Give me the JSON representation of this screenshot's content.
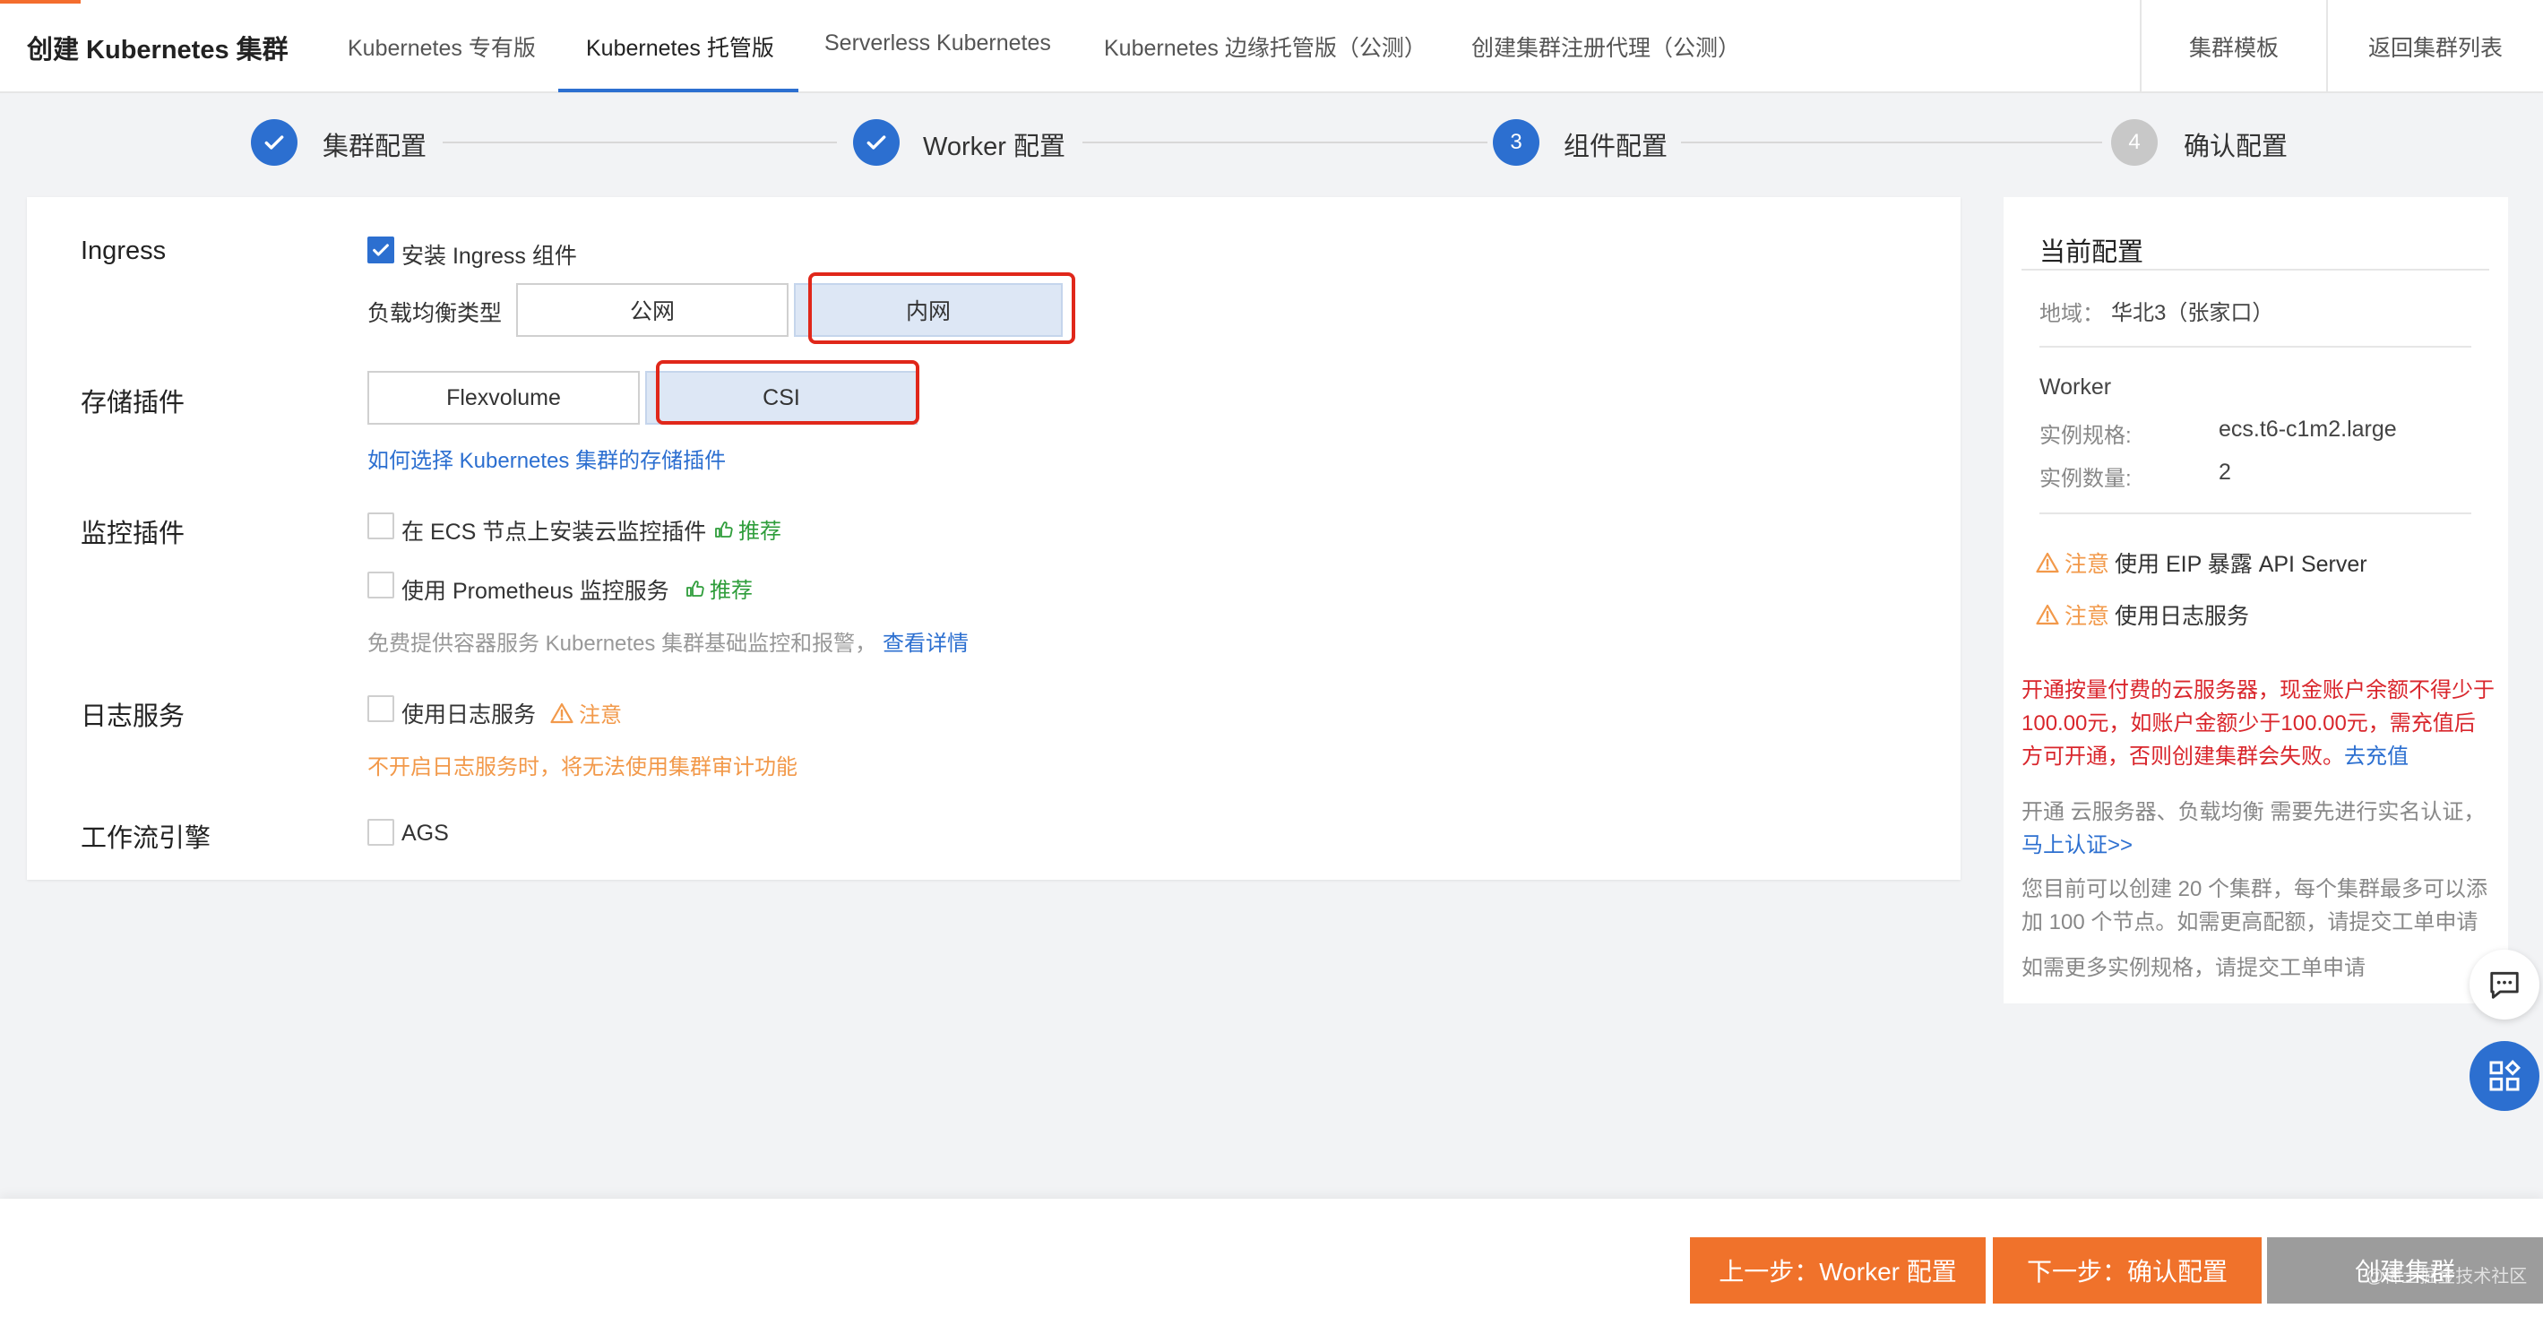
{
  "header": {
    "title": "创建 Kubernetes 集群",
    "tabs": [
      {
        "label": "Kubernetes 专有版"
      },
      {
        "label": "Kubernetes 托管版",
        "active": true
      },
      {
        "label": "Serverless Kubernetes"
      },
      {
        "label": "Kubernetes 边缘托管版（公测）"
      },
      {
        "label": "创建集群注册代理（公测）"
      }
    ],
    "template_btn": "集群模板",
    "back_btn": "返回集群列表"
  },
  "steps": [
    {
      "label": "集群配置",
      "state": "done"
    },
    {
      "label": "Worker 配置",
      "state": "done"
    },
    {
      "label": "组件配置",
      "state": "current",
      "num": "3"
    },
    {
      "label": "确认配置",
      "state": "todo",
      "num": "4"
    }
  ],
  "form": {
    "ingress": {
      "label": "Ingress",
      "install_label": "安装 Ingress 组件",
      "install_checked": true,
      "lb_type_label": "负载均衡类型",
      "lb_options": [
        "公网",
        "内网"
      ],
      "lb_selected": "内网"
    },
    "storage": {
      "label": "存储插件",
      "options": [
        "Flexvolume",
        "CSI"
      ],
      "selected": "CSI",
      "help_link": "如何选择 Kubernetes 集群的存储插件"
    },
    "monitor": {
      "label": "监控插件",
      "ecs_label": "在 ECS 节点上安装云监控插件",
      "prometheus_label": "使用 Prometheus 监控服务",
      "recommend": "推荐",
      "hint": "免费提供容器服务 Kubernetes 集群基础监控和报警，",
      "detail_link": "查看详情"
    },
    "log": {
      "label": "日志服务",
      "use_label": "使用日志服务",
      "notice": "注意",
      "warning": "不开启日志服务时，将无法使用集群审计功能"
    },
    "workflow": {
      "label": "工作流引擎",
      "ags_label": "AGS"
    }
  },
  "side": {
    "title": "当前配置",
    "region_label": "地域：",
    "region_value": "华北3（张家口）",
    "worker_title": "Worker",
    "spec_label": "实例规格:",
    "spec_value": "ecs.t6-c1m2.large",
    "count_label": "实例数量:",
    "count_value": "2",
    "notice_word": "注意",
    "notice1": "使用 EIP 暴露 API Server",
    "notice2": "使用日志服务",
    "red_text": "开通按量付费的云服务器，现金账户余额不得少于100.00元，如账户金额少于100.00元，需充值后方可开通，否则创建集群会失败。",
    "recharge_link": "去充值",
    "auth_text": "开通 云服务器、负载均衡 需要先进行实名认证，",
    "auth_link": "马上认证>>",
    "quota_text": "您目前可以创建 20 个集群，每个集群最多可以添加 100 个节点。如需更高配额，请提交工单申请",
    "more_text": "如需更多实例规格，请提交工单申请"
  },
  "footer": {
    "prev_btn": "上一步：Worker 配置",
    "next_btn": "下一步：确认配置",
    "create_btn": "创建集群",
    "watermark": "@稀土掘金技术社区"
  }
}
